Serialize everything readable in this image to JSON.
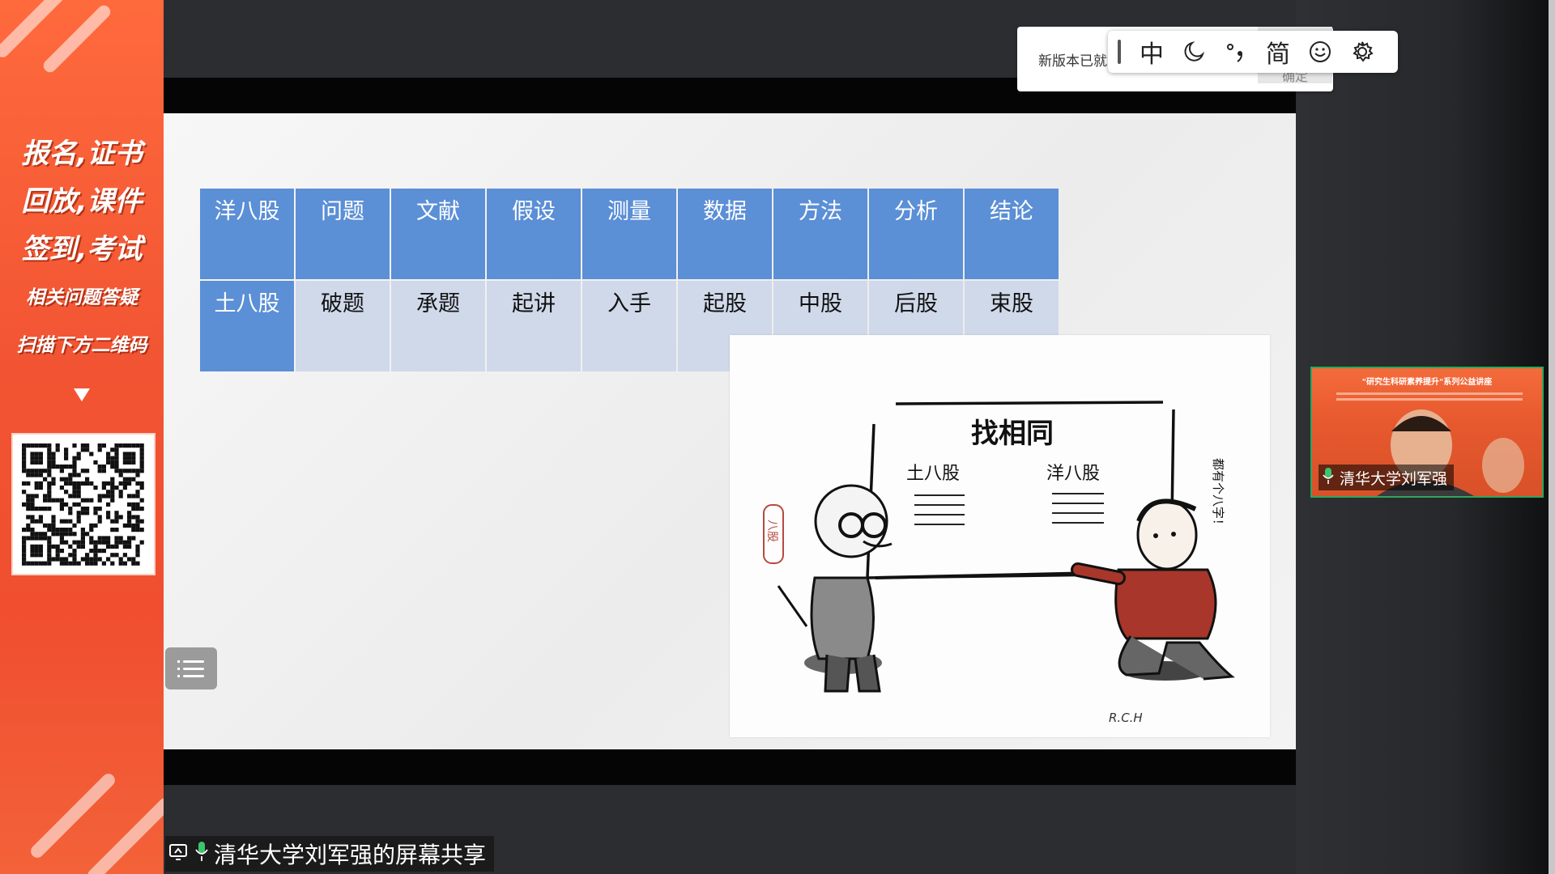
{
  "promo": {
    "line1": "报名,证书",
    "line2": "回放,课件",
    "line3": "签到,考试",
    "line4": "相关问题答疑",
    "line5": "扫描下方二维码"
  },
  "slide": {
    "table": {
      "row1": [
        "洋八股",
        "问题",
        "文献",
        "假设",
        "测量",
        "数据",
        "方法",
        "分析",
        "结论"
      ],
      "row2": [
        "土八股",
        "破题",
        "承题",
        "起讲",
        "入手",
        "起股",
        "中股",
        "后股",
        "束股"
      ]
    },
    "cartoon": {
      "board_title": "找相同",
      "left_label": "土八股",
      "right_label": "洋八股",
      "side_note": "都有个八字！",
      "seal_text": "八股",
      "signature": "R.C.H"
    }
  },
  "notification": {
    "text": "新版本已就",
    "confirm": "确定"
  },
  "ime": {
    "mode": "中",
    "script": "简",
    "icons": [
      "moon-icon",
      "punctuation-icon",
      "emoji-icon",
      "gear-icon"
    ]
  },
  "video": {
    "speaker": "清华大学刘军强",
    "banner": "\"研究生科研素养提升\"系列公益讲座"
  },
  "share_label": "清华大学刘军强的屏幕共享",
  "colors": {
    "accent_orange": "#f25533",
    "table_header": "#5b8fd6",
    "table_cell": "#cfd9ea",
    "tile_border": "#2fa65a"
  }
}
